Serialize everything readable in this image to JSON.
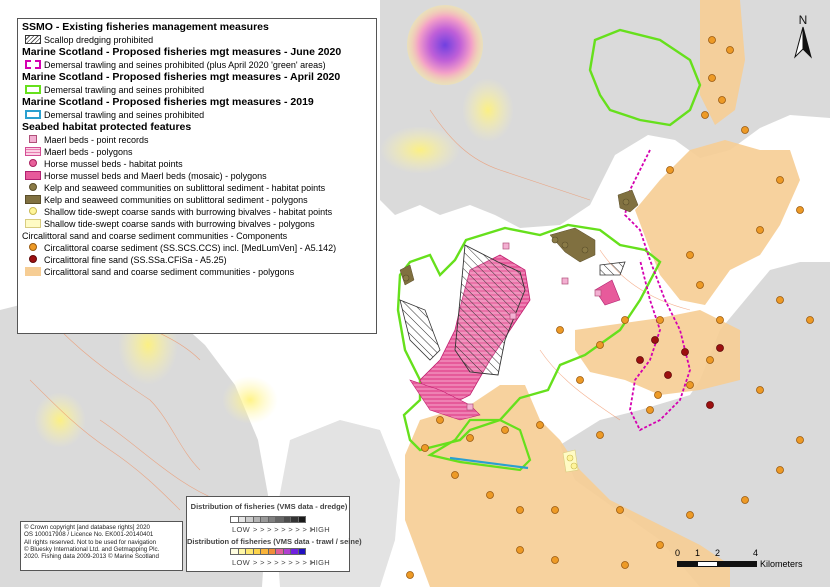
{
  "legend": {
    "ssmo_header": "SSMO - Existing fisheries management measures",
    "scallop": "Scallop dredging prohibited",
    "june_header": "Marine Scotland - Proposed fisheries mgt measures - June 2020",
    "june_item": "Demersal trawling and seines prohibited (plus April 2020 'green' areas)",
    "april_header": "Marine Scotland - Proposed fisheries mgt measures - April 2020",
    "april_item": "Demersal trawling and seines prohibited",
    "y2019_header": "Marine Scotland - Proposed fisheries mgt measures - 2019",
    "y2019_item": "Demersal trawling and seines prohibited",
    "seabed_header": "Seabed habitat protected features",
    "maerl_points": "Maerl beds - point records",
    "maerl_polygons": "Maerl beds - polygons",
    "horse_points": "Horse mussel beds - habitat points",
    "horse_polygons": "Horse mussel beds and Maerl beds (mosaic) - polygons",
    "kelp_points": "Kelp and seaweed communities on sublittoral sediment - habitat points",
    "kelp_polygons": "Kelp and seaweed communities on sublittoral sediment - polygons",
    "sand_points": "Shallow tide-swept coarse sands with burrowing bivalves - habitat points",
    "sand_polygons": "Shallow tide-swept coarse sands with burrowing bivalves - polygons",
    "circ_header": "Circalittoral sand and coarse sediment communities - Components",
    "circ_coarse": "Circalittoral coarse sediment (SS.SCS.CCS) incl. [MedLumVen] - A5.142)",
    "circ_fine": "Circalittoral fine sand (SS.SSa.CFiSa - A5.25)",
    "circ_polygons": "Circalittoral sand and coarse sediment communities - polygons"
  },
  "copyright": [
    "© Crown copyright [and database rights] 2020",
    "OS 100017908 / Licence No. EK001-20140401",
    "All rights reserved. Not to be used for navigation",
    "© Bluesky International Ltd. and Getmapping Plc.",
    "2020. Fishing data 2009-2013 © Marine Scotland"
  ],
  "vms": {
    "dredge_title": "Distribution of fisheries (VMS data - dredge)",
    "dredge_low": "LOW",
    "dredge_arrows": "> > > > > > > > >",
    "dredge_high": "HIGH",
    "trawl_title": "Distribution of fisheries (VMS data - trawl / seine)",
    "trawl_low": "LOW",
    "trawl_arrows": "> > > > > > > > >",
    "trawl_high": "HIGH",
    "dredge_colors": [
      "#ffffff",
      "#e6e6e6",
      "#cccccc",
      "#b3b3b3",
      "#999999",
      "#808080",
      "#666666",
      "#4d4d4d",
      "#333333",
      "#1a1a1a"
    ],
    "trawl_colors": [
      "#fffde0",
      "#fff7a8",
      "#ffe870",
      "#fdd44a",
      "#f9b43a",
      "#f08f3a",
      "#e0609a",
      "#b040d0",
      "#7020e0",
      "#2010c0"
    ]
  },
  "north_label": "N",
  "scale": {
    "ticks": [
      "0",
      "1",
      "2",
      "4"
    ],
    "unit": "Kilometers"
  },
  "colors": {
    "sea": "#ffffff",
    "land": "#dadada",
    "green_boundary": "#66e01c",
    "pink_boundary": "#d400b0",
    "blue_boundary": "#2aa0d0",
    "circalittoral": "#f6cd94",
    "horse_mussel": "#e75a9b",
    "coarse_point": "#ed9a26",
    "fine_point": "#9c1010",
    "kelp": "#807040"
  }
}
